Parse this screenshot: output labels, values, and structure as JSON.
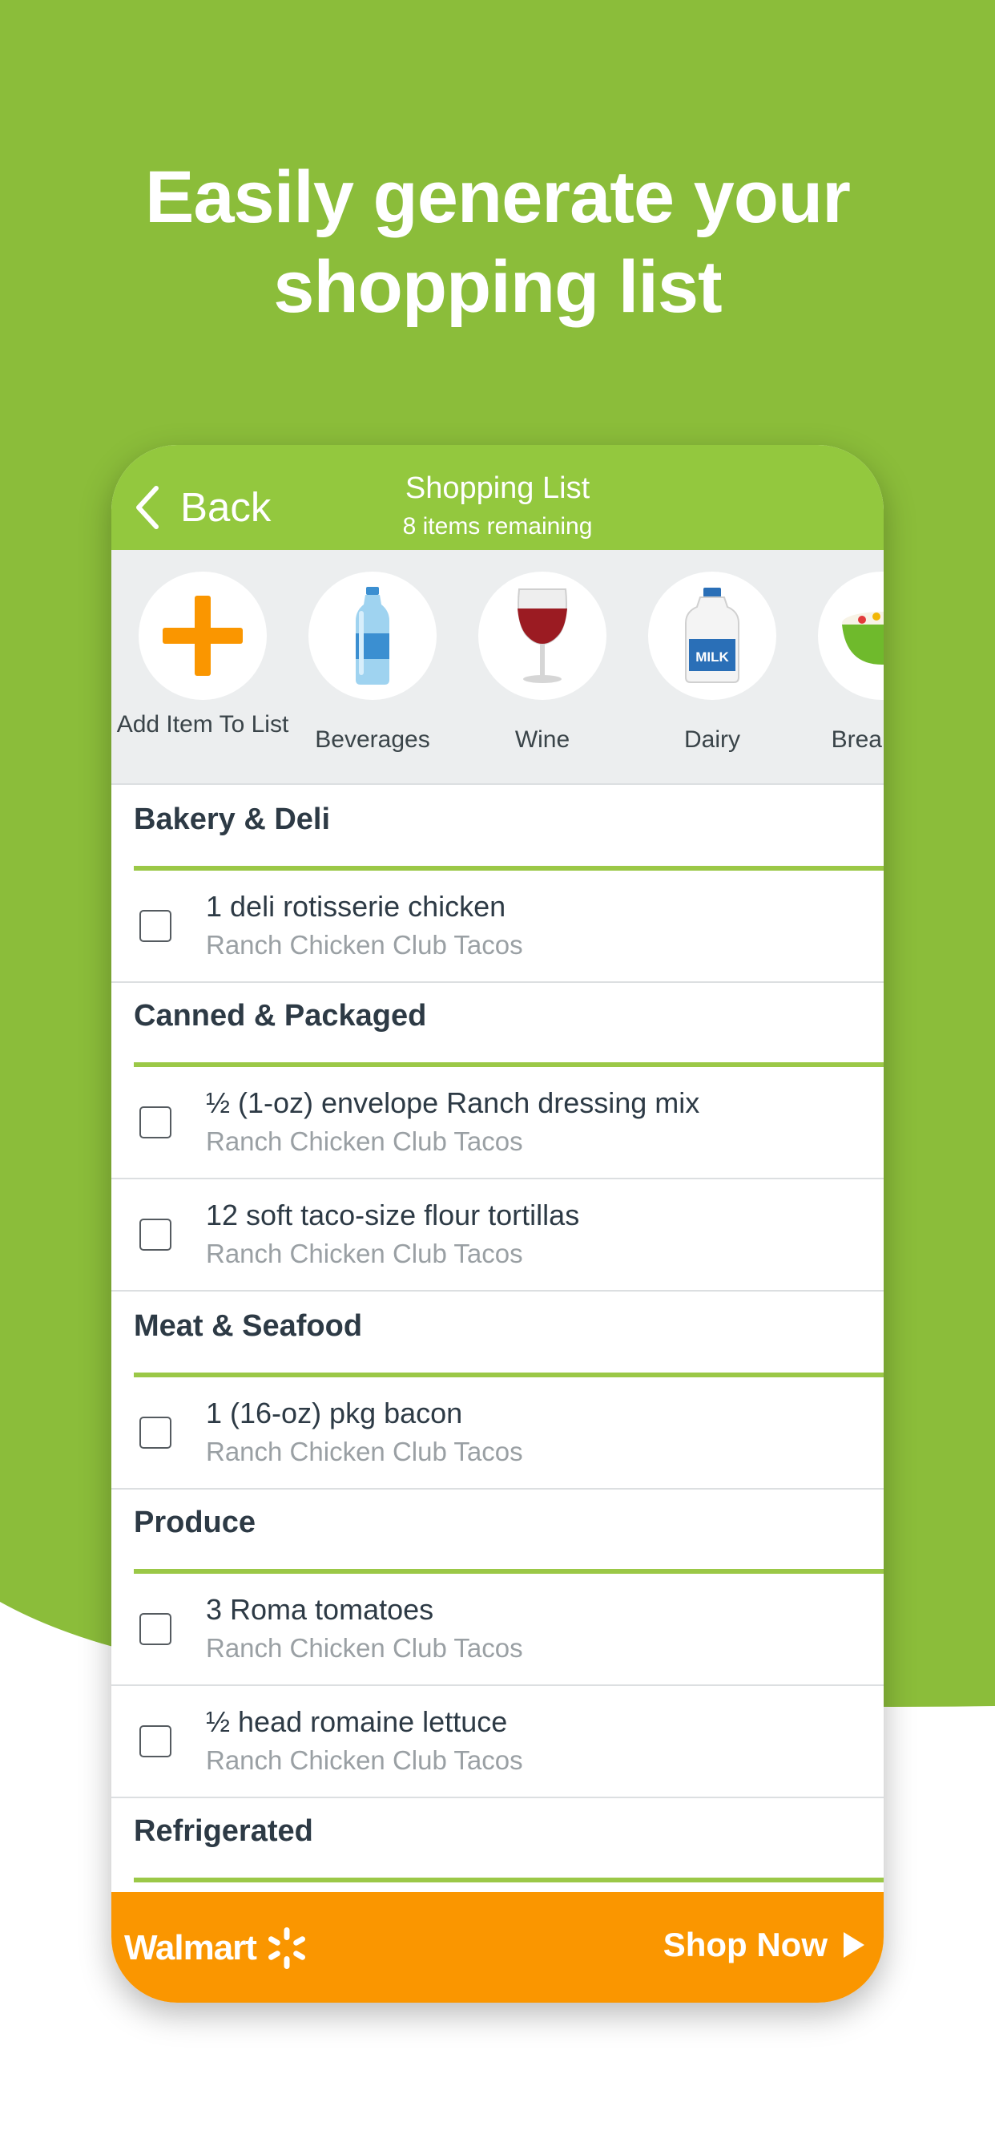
{
  "headline": {
    "line1": "Easily generate your",
    "line2": "shopping list"
  },
  "colors": {
    "brand_green": "#8bbd3a",
    "nav_green": "#93c83e",
    "accent_orange": "#fa9600",
    "divider_green": "#9bc847"
  },
  "nav": {
    "back_label": "Back",
    "title": "Shopping List",
    "subtitle": "8 items remaining"
  },
  "categories": [
    {
      "label": "Add Item To List",
      "icon": "plus-icon"
    },
    {
      "label": "Beverages",
      "icon": "water-bottle-icon"
    },
    {
      "label": "Wine",
      "icon": "wine-glass-icon"
    },
    {
      "label": "Dairy",
      "icon": "milk-jug-icon",
      "icon_text": "MILK"
    },
    {
      "label": "Breakfast",
      "icon": "cereal-bowl-icon"
    }
  ],
  "sections": [
    {
      "title": "Bakery & Deli",
      "items": [
        {
          "name": "1 deli rotisserie chicken",
          "recipe": "Ranch Chicken Club Tacos",
          "checked": false
        }
      ]
    },
    {
      "title": "Canned & Packaged",
      "items": [
        {
          "name": "½ (1-oz) envelope Ranch dressing mix",
          "recipe": "Ranch Chicken Club Tacos",
          "checked": false
        },
        {
          "name": "12 soft taco-size flour tortillas",
          "recipe": "Ranch Chicken Club Tacos",
          "checked": false
        }
      ]
    },
    {
      "title": "Meat & Seafood",
      "items": [
        {
          "name": "1 (16-oz) pkg bacon",
          "recipe": "Ranch Chicken Club Tacos",
          "checked": false
        }
      ]
    },
    {
      "title": "Produce",
      "items": [
        {
          "name": "3 Roma tomatoes",
          "recipe": "Ranch Chicken Club Tacos",
          "checked": false
        },
        {
          "name": "½ head romaine lettuce",
          "recipe": "Ranch Chicken Club Tacos",
          "checked": false
        }
      ]
    },
    {
      "title": "Refrigerated",
      "items": []
    }
  ],
  "footer": {
    "brand": "Walmart",
    "brand_icon": "spark-icon",
    "cta": "Shop Now",
    "cta_icon": "play-arrow-icon"
  }
}
